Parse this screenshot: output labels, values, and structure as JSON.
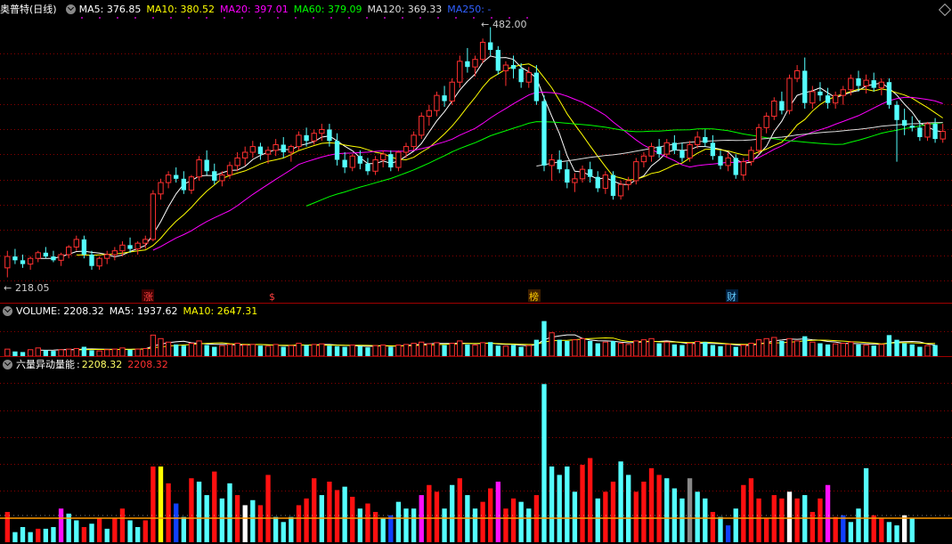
{
  "main_header": {
    "stock_title": "奥普特(日线)",
    "ma_items": [
      {
        "label": "MA5:",
        "value": "376.85",
        "color": "#ffffff"
      },
      {
        "label": "MA10:",
        "value": "380.52",
        "color": "#ffff00"
      },
      {
        "label": "MA20:",
        "value": "397.01",
        "color": "#ff00ff"
      },
      {
        "label": "MA60:",
        "value": "379.09",
        "color": "#00ff00"
      },
      {
        "label": "MA120:",
        "value": "369.33",
        "color": "#dddddd"
      },
      {
        "label": "MA250:",
        "value": "-",
        "color": "#3060ff"
      }
    ]
  },
  "price_labels": {
    "high": "482.00",
    "low": "218.05"
  },
  "event_markers": [
    {
      "text": "涨",
      "color": "#ff4040",
      "bg": "#400000"
    },
    {
      "text": "$",
      "color": "#ff4040",
      "bg": "#000000"
    },
    {
      "text": "榜",
      "color": "#ffcc00",
      "bg": "#402000"
    },
    {
      "text": "财",
      "color": "#66ccff",
      "bg": "#002040"
    }
  ],
  "volume_header": {
    "title": "VOLUME:",
    "value": "2208.32",
    "ma5_label": "MA5:",
    "ma5_value": "1937.62",
    "ma10_label": "MA10:",
    "ma10_value": "2647.31"
  },
  "indicator_header": {
    "title": "六量异动量能",
    "sep": ":",
    "value1": "2208.32",
    "value2": "2208.32"
  },
  "colors": {
    "up": "#ff3030",
    "down": "#54ffff",
    "grid": "#8b0000",
    "ma5": "#ffffff",
    "ma10": "#ffff00",
    "ma20": "#ff00ff",
    "ma60": "#00ff00",
    "ma120": "#dddddd"
  },
  "chart_data": {
    "type": "candlestick",
    "y_range": [
      210,
      490
    ],
    "ohlc": [
      [
        228,
        246,
        218,
        240
      ],
      [
        240,
        248,
        232,
        236
      ],
      [
        236,
        242,
        228,
        232
      ],
      [
        232,
        240,
        226,
        238
      ],
      [
        238,
        246,
        234,
        244
      ],
      [
        244,
        250,
        238,
        240
      ],
      [
        240,
        246,
        234,
        236
      ],
      [
        236,
        244,
        230,
        242
      ],
      [
        242,
        252,
        238,
        250
      ],
      [
        250,
        262,
        246,
        258
      ],
      [
        258,
        262,
        238,
        242
      ],
      [
        242,
        246,
        226,
        230
      ],
      [
        230,
        240,
        226,
        238
      ],
      [
        238,
        246,
        232,
        242
      ],
      [
        242,
        250,
        236,
        246
      ],
      [
        246,
        256,
        240,
        252
      ],
      [
        252,
        260,
        244,
        248
      ],
      [
        248,
        256,
        242,
        254
      ],
      [
        254,
        262,
        248,
        258
      ],
      [
        258,
        310,
        256,
        306
      ],
      [
        306,
        322,
        300,
        318
      ],
      [
        318,
        330,
        312,
        326
      ],
      [
        326,
        334,
        318,
        322
      ],
      [
        322,
        330,
        306,
        310
      ],
      [
        310,
        326,
        306,
        324
      ],
      [
        324,
        346,
        320,
        342
      ],
      [
        342,
        352,
        326,
        330
      ],
      [
        330,
        338,
        316,
        320
      ],
      [
        320,
        330,
        314,
        326
      ],
      [
        326,
        340,
        322,
        336
      ],
      [
        336,
        350,
        330,
        344
      ],
      [
        344,
        356,
        336,
        350
      ],
      [
        350,
        362,
        344,
        356
      ],
      [
        356,
        360,
        342,
        348
      ],
      [
        348,
        356,
        338,
        352
      ],
      [
        352,
        364,
        346,
        358
      ],
      [
        358,
        366,
        344,
        350
      ],
      [
        350,
        358,
        340,
        356
      ],
      [
        356,
        372,
        352,
        368
      ],
      [
        368,
        376,
        356,
        362
      ],
      [
        362,
        374,
        358,
        370
      ],
      [
        370,
        380,
        362,
        374
      ],
      [
        374,
        380,
        356,
        362
      ],
      [
        362,
        370,
        336,
        342
      ],
      [
        342,
        350,
        328,
        334
      ],
      [
        334,
        348,
        330,
        346
      ],
      [
        346,
        352,
        332,
        338
      ],
      [
        338,
        344,
        326,
        330
      ],
      [
        330,
        346,
        326,
        342
      ],
      [
        342,
        352,
        334,
        348
      ],
      [
        348,
        352,
        330,
        334
      ],
      [
        334,
        352,
        330,
        350
      ],
      [
        350,
        360,
        344,
        356
      ],
      [
        356,
        372,
        352,
        368
      ],
      [
        368,
        392,
        364,
        388
      ],
      [
        388,
        400,
        378,
        394
      ],
      [
        394,
        414,
        388,
        410
      ],
      [
        410,
        420,
        398,
        404
      ],
      [
        404,
        428,
        400,
        424
      ],
      [
        424,
        452,
        418,
        446
      ],
      [
        446,
        460,
        434,
        440
      ],
      [
        440,
        452,
        430,
        448
      ],
      [
        448,
        470,
        444,
        466
      ],
      [
        466,
        482,
        452,
        458
      ],
      [
        458,
        462,
        432,
        436
      ],
      [
        436,
        446,
        420,
        442
      ],
      [
        442,
        452,
        428,
        438
      ],
      [
        438,
        444,
        418,
        424
      ],
      [
        424,
        440,
        418,
        434
      ],
      [
        434,
        442,
        400,
        404
      ],
      [
        404,
        410,
        330,
        336
      ],
      [
        336,
        348,
        320,
        342
      ],
      [
        342,
        352,
        328,
        332
      ],
      [
        332,
        340,
        312,
        318
      ],
      [
        318,
        328,
        308,
        322
      ],
      [
        322,
        336,
        318,
        332
      ],
      [
        332,
        340,
        318,
        324
      ],
      [
        324,
        330,
        308,
        312
      ],
      [
        312,
        330,
        306,
        326
      ],
      [
        326,
        330,
        300,
        304
      ],
      [
        304,
        320,
        300,
        316
      ],
      [
        316,
        324,
        310,
        320
      ],
      [
        320,
        344,
        316,
        340
      ],
      [
        340,
        350,
        334,
        346
      ],
      [
        346,
        360,
        340,
        356
      ],
      [
        356,
        364,
        344,
        348
      ],
      [
        348,
        364,
        344,
        360
      ],
      [
        360,
        368,
        348,
        352
      ],
      [
        352,
        360,
        340,
        344
      ],
      [
        344,
        362,
        340,
        358
      ],
      [
        358,
        372,
        354,
        366
      ],
      [
        366,
        374,
        356,
        360
      ],
      [
        360,
        368,
        342,
        346
      ],
      [
        346,
        352,
        332,
        336
      ],
      [
        336,
        350,
        330,
        344
      ],
      [
        344,
        348,
        322,
        326
      ],
      [
        326,
        344,
        320,
        340
      ],
      [
        340,
        356,
        336,
        352
      ],
      [
        352,
        380,
        348,
        376
      ],
      [
        376,
        392,
        370,
        388
      ],
      [
        388,
        408,
        384,
        404
      ],
      [
        404,
        414,
        390,
        394
      ],
      [
        394,
        432,
        390,
        428
      ],
      [
        428,
        442,
        424,
        436
      ],
      [
        436,
        450,
        396,
        402
      ],
      [
        402,
        420,
        396,
        414
      ],
      [
        414,
        424,
        404,
        410
      ],
      [
        410,
        418,
        396,
        402
      ],
      [
        402,
        414,
        396,
        410
      ],
      [
        410,
        420,
        400,
        416
      ],
      [
        416,
        432,
        410,
        428
      ],
      [
        428,
        436,
        414,
        420
      ],
      [
        420,
        432,
        412,
        426
      ],
      [
        426,
        434,
        414,
        418
      ],
      [
        418,
        428,
        410,
        424
      ],
      [
        424,
        428,
        396,
        400
      ],
      [
        400,
        404,
        340,
        384
      ],
      [
        384,
        396,
        368,
        378
      ],
      [
        378,
        388,
        372,
        376
      ],
      [
        376,
        384,
        362,
        366
      ],
      [
        366,
        382,
        362,
        380
      ],
      [
        380,
        386,
        360,
        364
      ],
      [
        364,
        380,
        360,
        372
      ]
    ],
    "volume": [
      60,
      40,
      35,
      55,
      70,
      50,
      45,
      55,
      60,
      65,
      80,
      50,
      45,
      55,
      60,
      70,
      55,
      60,
      65,
      180,
      150,
      120,
      100,
      90,
      110,
      130,
      95,
      80,
      90,
      100,
      110,
      95,
      100,
      90,
      85,
      100,
      80,
      90,
      110,
      95,
      100,
      105,
      90,
      85,
      80,
      95,
      85,
      75,
      90,
      95,
      80,
      95,
      100,
      110,
      120,
      105,
      115,
      95,
      110,
      130,
      100,
      95,
      115,
      120,
      90,
      85,
      95,
      80,
      90,
      140,
      300,
      200,
      140,
      130,
      140,
      150,
      130,
      110,
      120,
      130,
      110,
      100,
      130,
      140,
      150,
      110,
      120,
      100,
      95,
      110,
      125,
      120,
      95,
      85,
      100,
      80,
      95,
      110,
      140,
      150,
      160,
      130,
      150,
      130,
      170,
      120,
      110,
      100,
      105,
      110,
      120,
      100,
      95,
      90,
      100,
      180,
      140,
      110,
      100,
      80,
      90,
      95
    ],
    "indicator": [
      {
        "v": 18,
        "c": "red"
      },
      {
        "v": 6,
        "c": "cyan"
      },
      {
        "v": 9,
        "c": "cyan"
      },
      {
        "v": 6,
        "c": "cyan"
      },
      {
        "v": 8,
        "c": "red"
      },
      {
        "v": 8,
        "c": "cyan"
      },
      {
        "v": 9,
        "c": "cyan"
      },
      {
        "v": 20,
        "c": "magenta"
      },
      {
        "v": 17,
        "c": "cyan"
      },
      {
        "v": 13,
        "c": "cyan"
      },
      {
        "v": 9,
        "c": "red"
      },
      {
        "v": 11,
        "c": "cyan"
      },
      {
        "v": 14,
        "c": "red"
      },
      {
        "v": 8,
        "c": "cyan"
      },
      {
        "v": 14,
        "c": "red"
      },
      {
        "v": 20,
        "c": "red"
      },
      {
        "v": 13,
        "c": "cyan"
      },
      {
        "v": 9,
        "c": "cyan"
      },
      {
        "v": 13,
        "c": "red"
      },
      {
        "v": 45,
        "c": "red"
      },
      {
        "v": 45,
        "c": "yellow"
      },
      {
        "v": 35,
        "c": "red"
      },
      {
        "v": 23,
        "c": "blue"
      },
      {
        "v": 15,
        "c": "cyan"
      },
      {
        "v": 38,
        "c": "red"
      },
      {
        "v": 36,
        "c": "cyan"
      },
      {
        "v": 28,
        "c": "cyan"
      },
      {
        "v": 42,
        "c": "red"
      },
      {
        "v": 26,
        "c": "cyan"
      },
      {
        "v": 35,
        "c": "cyan"
      },
      {
        "v": 28,
        "c": "red"
      },
      {
        "v": 22,
        "c": "white"
      },
      {
        "v": 25,
        "c": "cyan"
      },
      {
        "v": 22,
        "c": "red"
      },
      {
        "v": 40,
        "c": "red"
      },
      {
        "v": 15,
        "c": "cyan"
      },
      {
        "v": 12,
        "c": "cyan"
      },
      {
        "v": 15,
        "c": "cyan"
      },
      {
        "v": 22,
        "c": "red"
      },
      {
        "v": 26,
        "c": "red"
      },
      {
        "v": 38,
        "c": "red"
      },
      {
        "v": 28,
        "c": "cyan"
      },
      {
        "v": 36,
        "c": "red"
      },
      {
        "v": 31,
        "c": "red"
      },
      {
        "v": 33,
        "c": "cyan"
      },
      {
        "v": 27,
        "c": "red"
      },
      {
        "v": 20,
        "c": "cyan"
      },
      {
        "v": 23,
        "c": "red"
      },
      {
        "v": 18,
        "c": "red"
      },
      {
        "v": 14,
        "c": "cyan"
      },
      {
        "v": 16,
        "c": "blue"
      },
      {
        "v": 24,
        "c": "cyan"
      },
      {
        "v": 20,
        "c": "cyan"
      },
      {
        "v": 20,
        "c": "cyan"
      },
      {
        "v": 28,
        "c": "magenta"
      },
      {
        "v": 34,
        "c": "red"
      },
      {
        "v": 30,
        "c": "red"
      },
      {
        "v": 20,
        "c": "cyan"
      },
      {
        "v": 34,
        "c": "cyan"
      },
      {
        "v": 38,
        "c": "red"
      },
      {
        "v": 28,
        "c": "cyan"
      },
      {
        "v": 20,
        "c": "cyan"
      },
      {
        "v": 24,
        "c": "red"
      },
      {
        "v": 32,
        "c": "red"
      },
      {
        "v": 36,
        "c": "magenta"
      },
      {
        "v": 20,
        "c": "red"
      },
      {
        "v": 26,
        "c": "red"
      },
      {
        "v": 24,
        "c": "cyan"
      },
      {
        "v": 20,
        "c": "cyan"
      },
      {
        "v": 28,
        "c": "red"
      },
      {
        "v": 94,
        "c": "cyan"
      },
      {
        "v": 45,
        "c": "cyan"
      },
      {
        "v": 40,
        "c": "cyan"
      },
      {
        "v": 45,
        "c": "cyan"
      },
      {
        "v": 30,
        "c": "cyan"
      },
      {
        "v": 46,
        "c": "red"
      },
      {
        "v": 50,
        "c": "red"
      },
      {
        "v": 26,
        "c": "cyan"
      },
      {
        "v": 30,
        "c": "red"
      },
      {
        "v": 36,
        "c": "red"
      },
      {
        "v": 48,
        "c": "cyan"
      },
      {
        "v": 40,
        "c": "cyan"
      },
      {
        "v": 30,
        "c": "red"
      },
      {
        "v": 36,
        "c": "red"
      },
      {
        "v": 44,
        "c": "red"
      },
      {
        "v": 40,
        "c": "red"
      },
      {
        "v": 38,
        "c": "cyan"
      },
      {
        "v": 32,
        "c": "cyan"
      },
      {
        "v": 26,
        "c": "cyan"
      },
      {
        "v": 38,
        "c": "grey"
      },
      {
        "v": 30,
        "c": "cyan"
      },
      {
        "v": 26,
        "c": "cyan"
      },
      {
        "v": 18,
        "c": "red"
      },
      {
        "v": 15,
        "c": "cyan"
      },
      {
        "v": 10,
        "c": "blue"
      },
      {
        "v": 20,
        "c": "cyan"
      },
      {
        "v": 34,
        "c": "red"
      },
      {
        "v": 38,
        "c": "red"
      },
      {
        "v": 26,
        "c": "red"
      },
      {
        "v": 14,
        "c": "red"
      },
      {
        "v": 28,
        "c": "red"
      },
      {
        "v": 26,
        "c": "red"
      },
      {
        "v": 30,
        "c": "white"
      },
      {
        "v": 26,
        "c": "red"
      },
      {
        "v": 28,
        "c": "cyan"
      },
      {
        "v": 18,
        "c": "red"
      },
      {
        "v": 26,
        "c": "red"
      },
      {
        "v": 34,
        "c": "magenta"
      },
      {
        "v": 15,
        "c": "red"
      },
      {
        "v": 16,
        "c": "blue"
      },
      {
        "v": 12,
        "c": "cyan"
      },
      {
        "v": 20,
        "c": "cyan"
      },
      {
        "v": 44,
        "c": "cyan"
      },
      {
        "v": 16,
        "c": "red"
      },
      {
        "v": 14,
        "c": "red"
      },
      {
        "v": 12,
        "c": "cyan"
      },
      {
        "v": 10,
        "c": "cyan"
      },
      {
        "v": 16,
        "c": "white"
      },
      {
        "v": 14,
        "c": "cyan"
      }
    ]
  }
}
